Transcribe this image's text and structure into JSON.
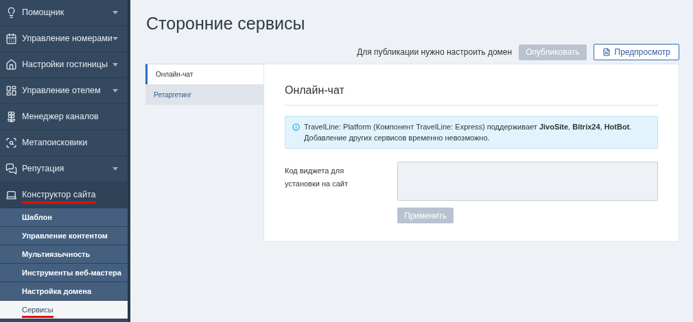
{
  "sidebar": {
    "items": [
      {
        "label": "Помощник",
        "has_caret": true,
        "marked": false
      },
      {
        "label": "Управление номерами",
        "has_caret": true,
        "marked": false
      },
      {
        "label": "Настройки гостиницы",
        "has_caret": true,
        "marked": false
      },
      {
        "label": "Управление отелем",
        "has_caret": true,
        "marked": false
      },
      {
        "label": "Менеджер каналов",
        "has_caret": false,
        "marked": false
      },
      {
        "label": "Метапоисковики",
        "has_caret": false,
        "marked": false
      },
      {
        "label": "Репутация",
        "has_caret": true,
        "marked": false
      },
      {
        "label": "Конструктор сайта",
        "has_caret": false,
        "marked": true,
        "children": [
          {
            "label": "Шаблон",
            "selected": false,
            "marked": false
          },
          {
            "label": "Управление контентом",
            "selected": false,
            "marked": false
          },
          {
            "label": "Мультиязычность",
            "selected": false,
            "marked": false
          },
          {
            "label": "Инструменты веб-мастера",
            "selected": false,
            "marked": false
          },
          {
            "label": "Настройка домена",
            "selected": false,
            "marked": false
          },
          {
            "label": "Сервисы",
            "selected": true,
            "marked": true
          }
        ]
      }
    ]
  },
  "page": {
    "title": "Сторонние сервисы",
    "publish_note": "Для публикации нужно настроить домен",
    "publish_button": {
      "label": "Опубликовать",
      "disabled": true
    },
    "preview_button": {
      "label": "Предпросмотр"
    }
  },
  "tabs": [
    {
      "label": "Онлайн-чат",
      "selected": true
    },
    {
      "label": "Ретаргетинг",
      "selected": false
    }
  ],
  "panel": {
    "heading": "Онлайн-чат",
    "info": "TravelLine: Platform (Компонент TravelLine: Express) поддерживает **JivoSite**, **Bitrix24**, **HotBot**. Добавление других сервисов временно невозможно.",
    "field_label": "Код виджета для установки на сайт",
    "field_disabled": true,
    "apply_button": {
      "label": "Применить",
      "disabled": true
    }
  }
}
